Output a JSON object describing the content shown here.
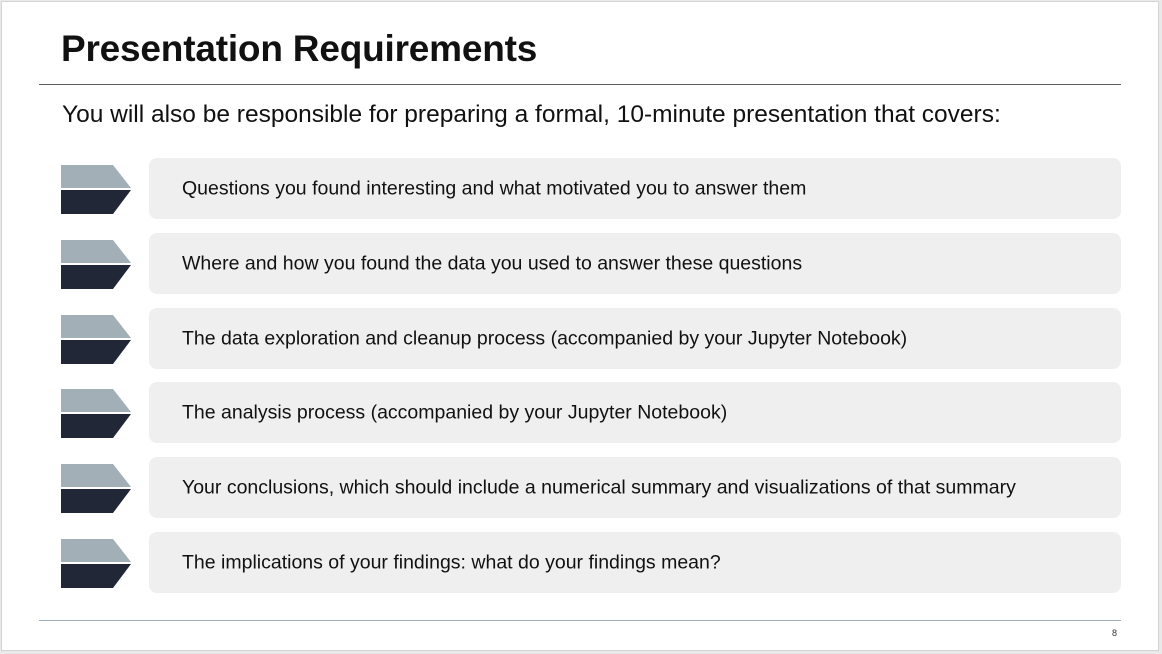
{
  "slide": {
    "title": "Presentation Requirements",
    "intro": "You will also be responsible for preparing a formal, 10-minute presentation that covers:",
    "page_number": "8"
  },
  "colors": {
    "chevron_top": "#a2afb6",
    "chevron_bottom": "#222738",
    "item_background": "#efefef",
    "footer_rule": "#9fb2bd"
  },
  "items": [
    {
      "icon": "chevron-bullet-icon",
      "text": "Questions you found interesting and what motivated you to answer them"
    },
    {
      "icon": "chevron-bullet-icon",
      "text": "Where and how you found the data you used to answer these questions"
    },
    {
      "icon": "chevron-bullet-icon",
      "text": "The data exploration and cleanup process (accompanied by your Jupyter Notebook)"
    },
    {
      "icon": "chevron-bullet-icon",
      "text": "The analysis process (accompanied by your Jupyter Notebook)"
    },
    {
      "icon": "chevron-bullet-icon",
      "text": "Your conclusions, which should include a numerical summary and visualizations of that summary"
    },
    {
      "icon": "chevron-bullet-icon",
      "text": "The implications of your findings: what do your findings mean?"
    }
  ]
}
